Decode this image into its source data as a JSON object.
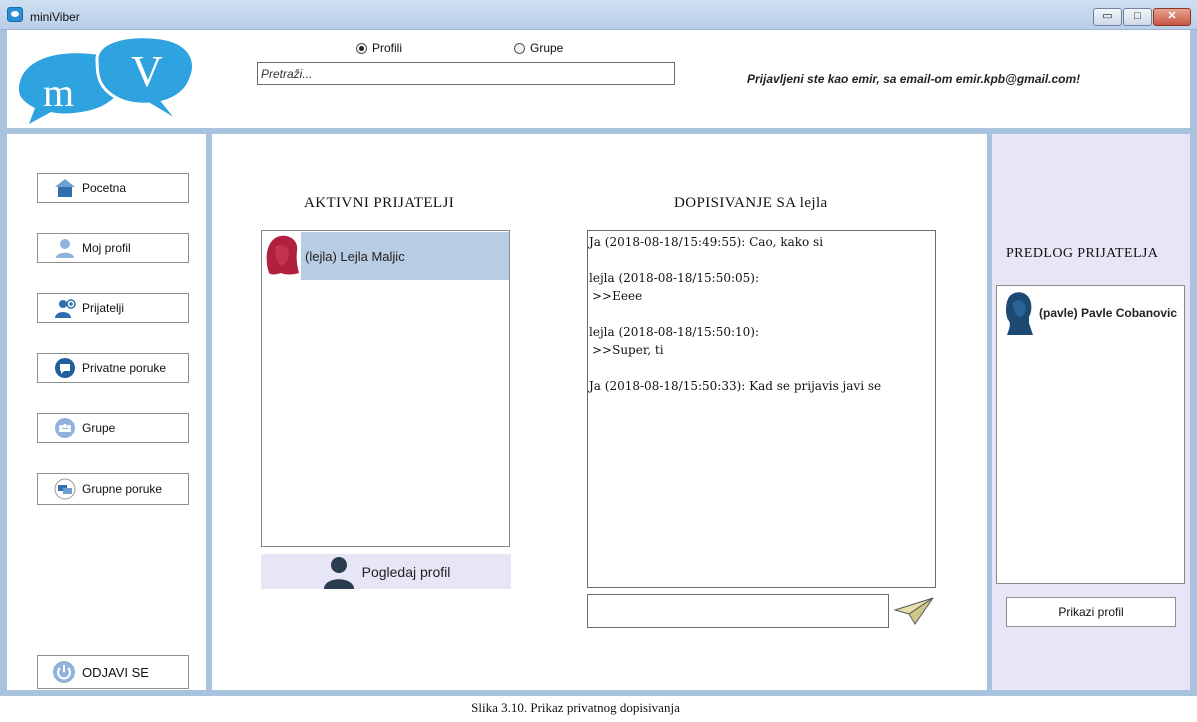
{
  "window": {
    "title": "miniViber",
    "minimize_label": "▭",
    "maximize_label": "□",
    "close_label": "✕"
  },
  "header": {
    "logo_text": "mV",
    "radio_profiles": "Profili",
    "radio_groups": "Grupe",
    "selected_radio": "Profili",
    "search_placeholder": "Pretraži...",
    "search_value": "",
    "logged_in_text": "Prijavljeni ste kao emir, sa email-om emir.kpb@gmail.com!"
  },
  "sidebar": {
    "items": [
      {
        "label": "Pocetna",
        "icon": "home-icon"
      },
      {
        "label": "Moj profil",
        "icon": "user-icon"
      },
      {
        "label": "Prijatelji",
        "icon": "friends-icon"
      },
      {
        "label": "Privatne poruke",
        "icon": "chat-icon"
      },
      {
        "label": "Grupe",
        "icon": "group-icon"
      },
      {
        "label": "Grupne poruke",
        "icon": "group-messages-icon"
      }
    ],
    "logout_label": "ODJAVI SE",
    "logout_icon": "power-icon"
  },
  "friends": {
    "title": "AKTIVNI PRIJATELJI",
    "items": [
      {
        "label": "(lejla) Lejla Maljic",
        "selected": true
      }
    ],
    "view_profile_label": "Pogledaj profil"
  },
  "chat": {
    "title": "DOPISIVANJE SA lejla",
    "messages": [
      {
        "header": "Ja (2018-08-18/15:49:55): Cao, kako si",
        "body": ""
      },
      {
        "header": "lejla (2018-08-18/15:50:05):",
        "body": ">>Eeee"
      },
      {
        "header": "lejla (2018-08-18/15:50:10):",
        "body": ">>Super, ti"
      },
      {
        "header": "Ja (2018-08-18/15:50:33): Kad se prijavis javi se",
        "body": ""
      }
    ],
    "input_value": "",
    "send_icon": "paper-plane-icon"
  },
  "suggestions": {
    "title": "PREDLOG PRIJATELJA",
    "items": [
      {
        "label": "(pavle) Pavle Cobanovic"
      }
    ],
    "show_profile_label": "Prikazi profil"
  },
  "caption": "Slika 3.10. Prikaz privatnog dopisivanja",
  "colors": {
    "accent": "#a9c2de",
    "selected_row": "#b8cce4",
    "side_panel": "#e6e6f7",
    "logo_blue": "#2ea3e0"
  }
}
